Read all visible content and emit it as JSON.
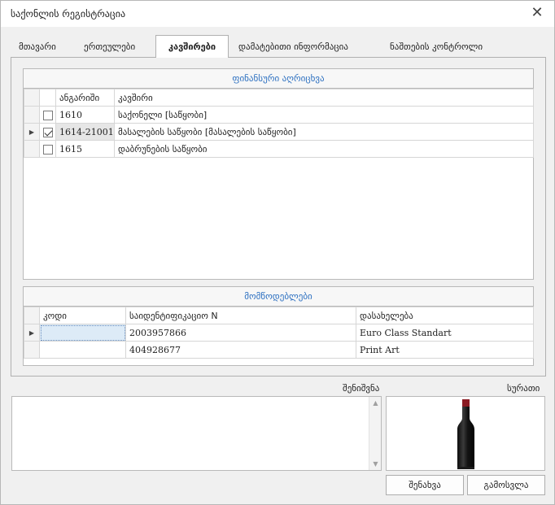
{
  "window": {
    "title": "საქონლის რეგისტრაცია"
  },
  "tabs": [
    {
      "label": "მთავარი"
    },
    {
      "label": "ერთეულები"
    },
    {
      "label": "კავშირები"
    },
    {
      "label": "დამატებითი ინფორმაცია"
    },
    {
      "label": "ნაშთების კონტროლი"
    }
  ],
  "finance": {
    "header": "ფინანსური აღრიცხვა",
    "columns": [
      "ანგარიში",
      "კავშირი"
    ],
    "rows": [
      {
        "checked": false,
        "account": "1610",
        "link": "საქონელი [საწყობი]"
      },
      {
        "checked": true,
        "account": "1614-21001",
        "link": "მასალების საწყობი [მასალების საწყობი]"
      },
      {
        "checked": false,
        "account": "1615",
        "link": "დაბრუნების საწყობი"
      }
    ]
  },
  "suppliers": {
    "header": "მომწოდებლები",
    "columns": [
      "კოდი",
      "საიდენტიფიკაციო N",
      "დასახელება"
    ],
    "rows": [
      {
        "code": "",
        "id": "2003957866",
        "name": "Euro Class Standart"
      },
      {
        "code": "",
        "id": "404928677",
        "name": "Print Art"
      }
    ]
  },
  "note": {
    "label": "შენიშვნა",
    "value": ""
  },
  "photo": {
    "label": "სურათი"
  },
  "buttons": {
    "save": "შენახვა",
    "exit": "გამოსვლა"
  },
  "icons": {
    "close": "close-icon",
    "row_pointer": "row-pointer-icon",
    "photo": "wine-bottle-image"
  }
}
